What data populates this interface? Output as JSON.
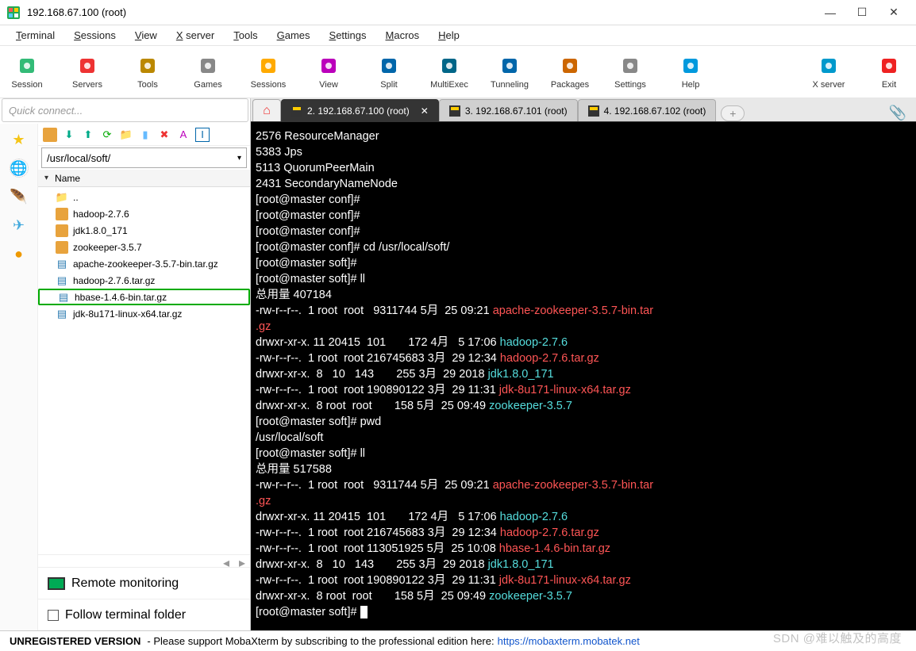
{
  "window": {
    "title": "192.168.67.100 (root)"
  },
  "menus": [
    "Terminal",
    "Sessions",
    "View",
    "X server",
    "Tools",
    "Games",
    "Settings",
    "Macros",
    "Help"
  ],
  "toolbar": [
    {
      "label": "Session",
      "color": "#3b7"
    },
    {
      "label": "Servers",
      "color": "#e33"
    },
    {
      "label": "Tools",
      "color": "#b80"
    },
    {
      "label": "Games",
      "color": "#888"
    },
    {
      "label": "Sessions",
      "color": "#fa0"
    },
    {
      "label": "View",
      "color": "#b0b"
    },
    {
      "label": "Split",
      "color": "#06a"
    },
    {
      "label": "MultiExec",
      "color": "#068"
    },
    {
      "label": "Tunneling",
      "color": "#06a"
    },
    {
      "label": "Packages",
      "color": "#c60"
    },
    {
      "label": "Settings",
      "color": "#888"
    },
    {
      "label": "Help",
      "color": "#09d"
    }
  ],
  "toolbar_right": [
    {
      "label": "X server",
      "color": "#09c"
    },
    {
      "label": "Exit",
      "color": "#e22"
    }
  ],
  "quick_connect_placeholder": "Quick connect...",
  "ft_path": "/usr/local/soft/",
  "ft_header_name": "Name",
  "ft_items": [
    {
      "icon": "up",
      "name": ".."
    },
    {
      "icon": "folder",
      "name": "hadoop-2.7.6"
    },
    {
      "icon": "folder",
      "name": "jdk1.8.0_171"
    },
    {
      "icon": "folder",
      "name": "zookeeper-3.5.7"
    },
    {
      "icon": "gz",
      "name": "apache-zookeeper-3.5.7-bin.tar.gz"
    },
    {
      "icon": "gz",
      "name": "hadoop-2.7.6.tar.gz"
    },
    {
      "icon": "gz",
      "name": "hbase-1.4.6-bin.tar.gz",
      "highlight": true
    },
    {
      "icon": "gz",
      "name": "jdk-8u171-linux-x64.tar.gz"
    }
  ],
  "remote_monitoring_label": "Remote monitoring",
  "follow_terminal_label": "Follow terminal folder",
  "tabs": [
    {
      "label": "",
      "home": true
    },
    {
      "label": "2. 192.168.67.100 (root)",
      "active": true,
      "close": true
    },
    {
      "label": "3. 192.168.67.101 (root)"
    },
    {
      "label": "4. 192.168.67.102 (root)"
    }
  ],
  "terminal_lines": [
    [
      {
        "t": "2576 ResourceManager"
      }
    ],
    [
      {
        "t": "5383 Jps"
      }
    ],
    [
      {
        "t": "5113 QuorumPeerMain"
      }
    ],
    [
      {
        "t": "2431 SecondaryNameNode"
      }
    ],
    [
      {
        "t": "[root@master conf]# "
      }
    ],
    [
      {
        "t": "[root@master conf]# "
      }
    ],
    [
      {
        "t": "[root@master conf]# "
      }
    ],
    [
      {
        "t": "[root@master conf]# cd /usr/local/soft/"
      }
    ],
    [
      {
        "t": "[root@master soft]# "
      }
    ],
    [
      {
        "t": "[root@master soft]# ll"
      }
    ],
    [
      {
        "t": "总用量 407184"
      }
    ],
    [
      {
        "t": "-rw-r--r--.  1 root  root   9311744 5月  25 09:21 "
      },
      {
        "c": "c-red",
        "t": "apache-zookeeper-3.5.7-bin.tar"
      }
    ],
    [
      {
        "c": "c-red",
        "t": ".gz"
      }
    ],
    [
      {
        "t": "drwxr-xr-x. 11 20415  101       172 4月   5 17:06 "
      },
      {
        "c": "c-cyan",
        "t": "hadoop-2.7.6"
      }
    ],
    [
      {
        "t": "-rw-r--r--.  1 root  root 216745683 3月  29 12:34 "
      },
      {
        "c": "c-red",
        "t": "hadoop-2.7.6.tar.gz"
      }
    ],
    [
      {
        "t": "drwxr-xr-x.  8   10   143       255 3月  29 2018 "
      },
      {
        "c": "c-cyan",
        "t": "jdk1.8.0_171"
      }
    ],
    [
      {
        "t": "-rw-r--r--.  1 root  root 190890122 3月  29 11:31 "
      },
      {
        "c": "c-red",
        "t": "jdk-8u171-linux-x64.tar.gz"
      }
    ],
    [
      {
        "t": "drwxr-xr-x.  8 root  root       158 5月  25 09:49 "
      },
      {
        "c": "c-cyan",
        "t": "zookeeper-3.5.7"
      }
    ],
    [
      {
        "t": "[root@master soft]# pwd"
      }
    ],
    [
      {
        "t": "/usr/local/soft"
      }
    ],
    [
      {
        "t": "[root@master soft]# ll"
      }
    ],
    [
      {
        "t": "总用量 517588"
      }
    ],
    [
      {
        "t": "-rw-r--r--.  1 root  root   9311744 5月  25 09:21 "
      },
      {
        "c": "c-red",
        "t": "apache-zookeeper-3.5.7-bin.tar"
      }
    ],
    [
      {
        "c": "c-red",
        "t": ".gz"
      }
    ],
    [
      {
        "t": "drwxr-xr-x. 11 20415  101       172 4月   5 17:06 "
      },
      {
        "c": "c-cyan",
        "t": "hadoop-2.7.6"
      }
    ],
    [
      {
        "t": "-rw-r--r--.  1 root  root 216745683 3月  29 12:34 "
      },
      {
        "c": "c-red",
        "t": "hadoop-2.7.6.tar.gz"
      }
    ],
    [
      {
        "t": "-rw-r--r--.  1 root  root 113051925 5月  25 10:08 "
      },
      {
        "c": "c-red",
        "t": "hbase-1.4.6-bin.tar.gz"
      }
    ],
    [
      {
        "t": "drwxr-xr-x.  8   10   143       255 3月  29 2018 "
      },
      {
        "c": "c-cyan",
        "t": "jdk1.8.0_171"
      }
    ],
    [
      {
        "t": "-rw-r--r--.  1 root  root 190890122 3月  29 11:31 "
      },
      {
        "c": "c-red",
        "t": "jdk-8u171-linux-x64.tar.gz"
      }
    ],
    [
      {
        "t": "drwxr-xr-x.  8 root  root       158 5月  25 09:49 "
      },
      {
        "c": "c-cyan",
        "t": "zookeeper-3.5.7"
      }
    ],
    [
      {
        "t": "[root@master soft]# "
      },
      {
        "cursor": true
      }
    ]
  ],
  "status": {
    "unreg": "UNREGISTERED VERSION",
    "text": " -  Please support MobaXterm by subscribing to the professional edition here:  ",
    "link": "https://mobaxterm.mobatek.net"
  },
  "watermark": "SDN @难以触及的高度"
}
